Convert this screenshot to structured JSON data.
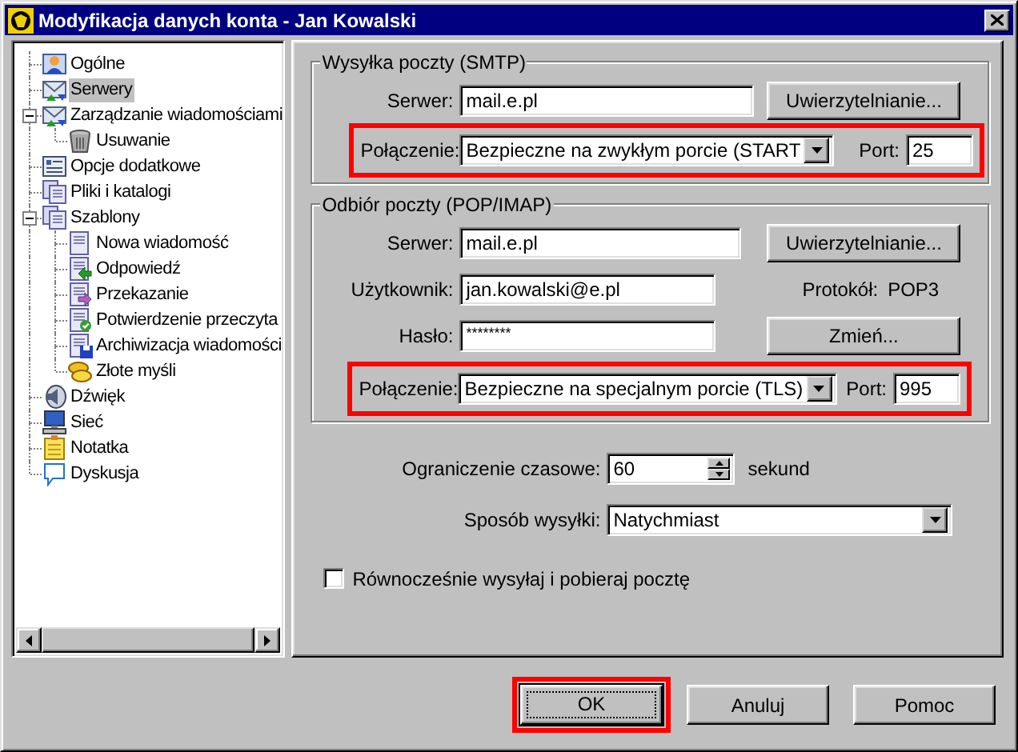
{
  "window": {
    "title": "Modyfikacja danych konta - Jan Kowalski"
  },
  "tree": {
    "items": [
      {
        "label": "Ogólne",
        "selected": false
      },
      {
        "label": "Serwery",
        "selected": true
      },
      {
        "label": "Zarządzanie wiadomościami",
        "selected": false,
        "expanded": true,
        "children": [
          {
            "label": "Usuwanie",
            "selected": false
          }
        ]
      },
      {
        "label": "Opcje dodatkowe",
        "selected": false
      },
      {
        "label": "Pliki i katalogi",
        "selected": false
      },
      {
        "label": "Szablony",
        "selected": false,
        "expanded": true,
        "children": [
          {
            "label": "Nowa wiadomość",
            "selected": false
          },
          {
            "label": "Odpowiedź",
            "selected": false
          },
          {
            "label": "Przekazanie",
            "selected": false
          },
          {
            "label": "Potwierdzenie przeczyta",
            "selected": false
          },
          {
            "label": "Archiwizacja wiadomości",
            "selected": false
          },
          {
            "label": "Złote myśli",
            "selected": false
          }
        ]
      },
      {
        "label": "Dźwięk",
        "selected": false
      },
      {
        "label": "Sieć",
        "selected": false
      },
      {
        "label": "Notatka",
        "selected": false
      },
      {
        "label": "Dyskusja",
        "selected": false
      }
    ]
  },
  "smtp": {
    "legend": "Wysyłka poczty (SMTP)",
    "server_label": "Serwer:",
    "server": "mail.e.pl",
    "auth_button": "Uwierzytelnianie...",
    "connection_label": "Połączenie:",
    "connection": "Bezpieczne na zwykłym porcie (START",
    "port_label": "Port:",
    "port": "25",
    "highlighted": true
  },
  "pop": {
    "legend": "Odbiór poczty (POP/IMAP)",
    "server_label": "Serwer:",
    "server": "mail.e.pl",
    "auth_button": "Uwierzytelnianie...",
    "user_label": "Użytkownik:",
    "user": "jan.kowalski@e.pl",
    "protocol_label": "Protokół:",
    "protocol": "POP3",
    "password_label": "Hasło:",
    "password": "********",
    "change_button": "Zmień...",
    "connection_label": "Połączenie:",
    "connection": "Bezpieczne na specjalnym porcie (TLS)",
    "port_label": "Port:",
    "port": "995",
    "highlighted": true
  },
  "timeout": {
    "label": "Ograniczenie czasowe:",
    "value": "60",
    "unit": "sekund"
  },
  "send_mode": {
    "label": "Sposób wysyłki:",
    "value": "Natychmiast"
  },
  "simultaneous": {
    "label": "Równocześnie wysyłaj i pobieraj pocztę",
    "checked": false
  },
  "buttons": [
    {
      "label": "OK",
      "default": true,
      "highlighted": true
    },
    {
      "label": "Anuluj",
      "default": false,
      "highlighted": false
    },
    {
      "label": "Pomoc",
      "default": false,
      "highlighted": false
    }
  ]
}
